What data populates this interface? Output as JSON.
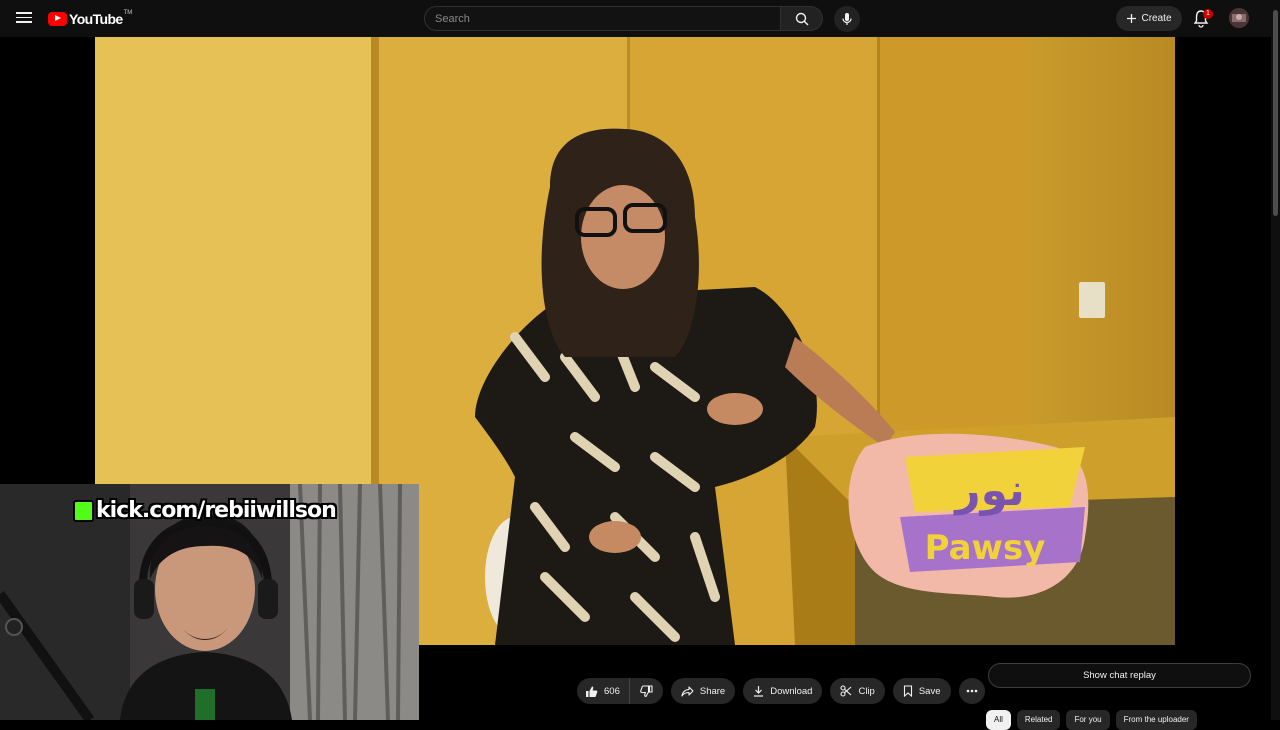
{
  "header": {
    "logo_text": "YouTube",
    "logo_tm": "TM",
    "search_placeholder": "Search",
    "create_label": "Create",
    "notification_count": "1"
  },
  "video": {
    "overlay_logo_line1": "نور",
    "overlay_logo_line2": "Pawsy"
  },
  "webcam": {
    "overlay_url": "kick.com/rebiiwillson"
  },
  "actions": {
    "like_count": "606",
    "share_label": "Share",
    "download_label": "Download",
    "clip_label": "Clip",
    "save_label": "Save"
  },
  "chat": {
    "show_replay_label": "Show chat replay"
  },
  "chips": [
    "All",
    "Related",
    "For you",
    "From the uploader"
  ],
  "colors": {
    "brand_red": "#ff0000",
    "bg": "#0f0f0f",
    "pill_bg": "#272727",
    "kick_green": "#53fc18"
  }
}
